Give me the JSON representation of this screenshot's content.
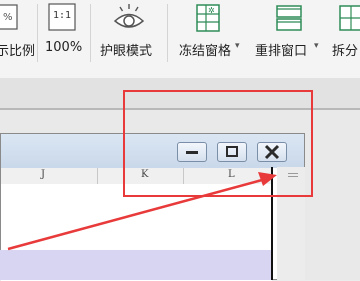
{
  "ribbon": {
    "items": [
      {
        "label": "示比例",
        "icon": "zoom-icon"
      },
      {
        "label": "100%",
        "icon": "one-to-one-icon",
        "icon_text": "1:1"
      },
      {
        "label": "护眼模式",
        "icon": "eye-icon"
      },
      {
        "label": "冻结窗格",
        "icon": "freeze-panes-icon",
        "dropdown": "▾"
      },
      {
        "label": "重排窗口",
        "icon": "arrange-windows-icon",
        "dropdown": "▾"
      },
      {
        "label": "拆分",
        "icon": "split-icon"
      }
    ]
  },
  "workbook_window": {
    "buttons": [
      "minimize-icon",
      "restore-icon",
      "close-icon"
    ],
    "columns": [
      "J",
      "K",
      "L"
    ]
  },
  "colors": {
    "annotation_red": "#e83a3a",
    "title_bar": "#cfdcec",
    "purple_row": "#d8d5f3"
  }
}
